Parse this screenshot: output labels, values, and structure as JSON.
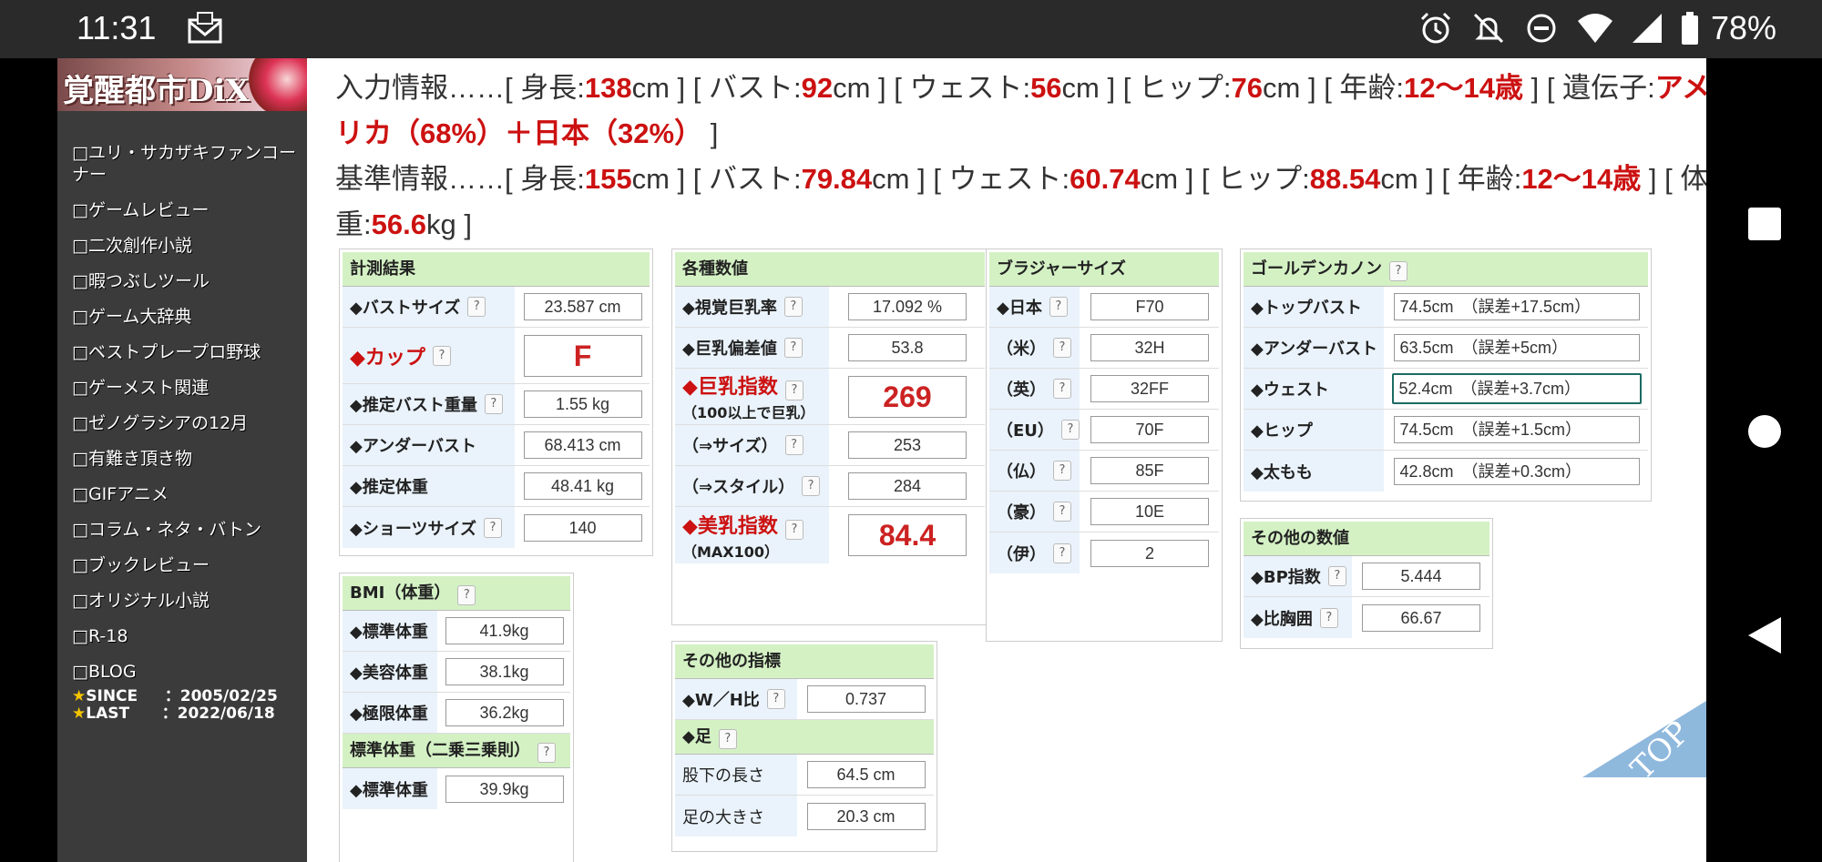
{
  "status": {
    "time": "11:31",
    "battery": "78%"
  },
  "site": {
    "logo": "覚醒都市DiX"
  },
  "menu": [
    "□ユリ・サカザキファンコーナー",
    "□ゲームレビュー",
    "□二次創作小説",
    "□暇つぶしツール",
    "□ゲーム大辞典",
    "□ベストプレープロ野球",
    "□ゲーメスト関連",
    "□ゼノグラシアの12月",
    "□有難き頂き物",
    "□GIFアニメ",
    "□コラム・ネタ・バトン",
    "□ブックレビュー",
    "□オリジナル小説",
    "□R-18",
    "□BLOG"
  ],
  "since": {
    "label1": "SINCE",
    "date1": "：2005/02/25",
    "label2": "LAST",
    "date2": "：2022/06/18"
  },
  "input_info": {
    "prefix": "入力情報……[ 身長:",
    "height": "138",
    "t1": "cm ] [ バスト:",
    "bust": "92",
    "t2": "cm ] [ ウェスト:",
    "waist": "56",
    "t3": "cm ] [ ヒップ:",
    "hip": "76",
    "t4": "cm ] [ 年齢:",
    "age": "12〜14歳",
    "t5": " ] [ 遺伝子:",
    "gene1": "アメ",
    "gene2": "リカ（68%）＋日本（32%）",
    "t6": " ]"
  },
  "base_info": {
    "prefix": "基準情報……[ 身長:",
    "height": "155",
    "t1": "cm ] [ バスト:",
    "bust": "79.84",
    "t2": "cm ] [ ウェスト:",
    "waist": "60.74",
    "t3": "cm ] [ ヒップ:",
    "hip": "88.54",
    "t4": "cm ] [ 年齢:",
    "age": "12〜14歳",
    "t5": " ] [ 体",
    "w_prefix": "重:",
    "weight": "56.6",
    "t6": "kg ]"
  },
  "measure": {
    "title": "計測結果",
    "rows": [
      {
        "label": "◆バストサイズ",
        "value": "23.587 cm"
      },
      {
        "label": "◆カップ",
        "value": "F"
      },
      {
        "label": "◆推定バスト重量",
        "value": "1.55 kg"
      },
      {
        "label": "◆アンダーバスト",
        "value": "68.413 cm"
      },
      {
        "label": "◆推定体重",
        "value": "48.41 kg"
      },
      {
        "label": "◆ショーツサイズ",
        "value": "140"
      }
    ]
  },
  "bmi": {
    "title": "BMI（体重）",
    "rows": [
      {
        "label": "◆標準体重",
        "value": "41.9kg"
      },
      {
        "label": "◆美容体重",
        "value": "38.1kg"
      },
      {
        "label": "◆極限体重",
        "value": "36.2kg"
      }
    ],
    "sub_title": "標準体重（二乗三乗則）",
    "sub_row": {
      "label": "◆標準体重",
      "value": "39.9kg"
    }
  },
  "various": {
    "title": "各種数値",
    "rows": [
      {
        "label": "◆視覚巨乳率",
        "value": "17.092 %"
      },
      {
        "label": "◆巨乳偏差値",
        "value": "53.8"
      },
      {
        "label": "◆巨乳指数",
        "sub": "（100以上で巨乳）",
        "value": "269"
      },
      {
        "label": "（⇒サイズ）",
        "value": "253"
      },
      {
        "label": "（⇒スタイル）",
        "value": "284"
      },
      {
        "label": "◆美乳指数",
        "sub": "（MAX100）",
        "value": "84.4"
      }
    ]
  },
  "other_index": {
    "title": "その他の指標",
    "row": {
      "label": "◆W／H比",
      "value": "0.737"
    },
    "foot_title": "◆足",
    "foot_rows": [
      {
        "label": "股下の長さ",
        "value": "64.5 cm"
      },
      {
        "label": "足の大きさ",
        "value": "20.3 cm"
      }
    ]
  },
  "bra": {
    "title": "ブラジャーサイズ",
    "rows": [
      {
        "label": "◆日本",
        "value": "F70"
      },
      {
        "label": "（米）",
        "value": "32H"
      },
      {
        "label": "（英）",
        "value": "32FF"
      },
      {
        "label": "（EU）",
        "value": "70F"
      },
      {
        "label": "（仏）",
        "value": "85F"
      },
      {
        "label": "（豪）",
        "value": "10E"
      },
      {
        "label": "（伊）",
        "value": "2"
      }
    ]
  },
  "golden": {
    "title": "ゴールデンカノン",
    "rows": [
      {
        "label": "◆トップバスト",
        "value": "74.5cm　（誤差+17.5cm）"
      },
      {
        "label": "◆アンダーバスト",
        "value": "63.5cm　（誤差+5cm）"
      },
      {
        "label": "◆ウェスト",
        "value": "52.4cm　（誤差+3.7cm）"
      },
      {
        "label": "◆ヒップ",
        "value": "74.5cm　（誤差+1.5cm）"
      },
      {
        "label": "◆太もも",
        "value": "42.8cm　（誤差+0.3cm）"
      }
    ]
  },
  "other_values": {
    "title": "その他の数値",
    "rows": [
      {
        "label": "◆BP指数",
        "value": "5.444"
      },
      {
        "label": "◆比胸囲",
        "value": "66.67"
      }
    ]
  },
  "top_label": "TOP",
  "help": "?"
}
